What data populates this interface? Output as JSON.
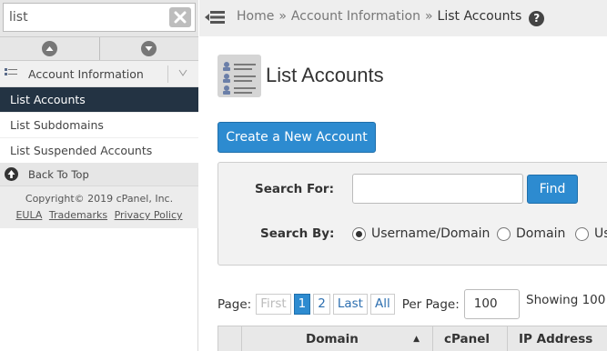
{
  "sidebar": {
    "search_value": "list",
    "category": "Account Information",
    "items": [
      {
        "label": "List Accounts",
        "active": true
      },
      {
        "label": "List Subdomains",
        "active": false
      },
      {
        "label": "List Suspended Accounts",
        "active": false
      }
    ],
    "back_to_top": "Back To Top",
    "copyright": "Copyright© 2019 cPanel, Inc.",
    "footer_links": [
      "EULA",
      "Trademarks",
      "Privacy Policy"
    ]
  },
  "breadcrumb": {
    "home": "Home",
    "parent": "Account Information",
    "current": "List Accounts",
    "separator": "»",
    "help": "?"
  },
  "main": {
    "title": "List Accounts",
    "create_button": "Create a New Account",
    "search_for_label": "Search For:",
    "search_for_value": "",
    "find_button": "Find",
    "search_by_label": "Search By:",
    "search_by_options": [
      {
        "label": "Username/Domain",
        "checked": true
      },
      {
        "label": "Domain",
        "checked": false
      },
      {
        "label": "Us",
        "checked": false
      }
    ],
    "pager": {
      "label": "Page:",
      "first": "First",
      "pages": [
        "1",
        "2"
      ],
      "current_page": "1",
      "last": "Last",
      "all": "All",
      "per_page_label": "Per Page:",
      "per_page_value": "100",
      "showing": "Showing 100"
    },
    "table_headers": [
      "Domain",
      "cPanel",
      "IP Address"
    ],
    "sort_indicator": "▲"
  },
  "colors": {
    "accent": "#2d8bd0",
    "sidebar_active": "#233343",
    "topbar_bg": "#eeeeee"
  }
}
